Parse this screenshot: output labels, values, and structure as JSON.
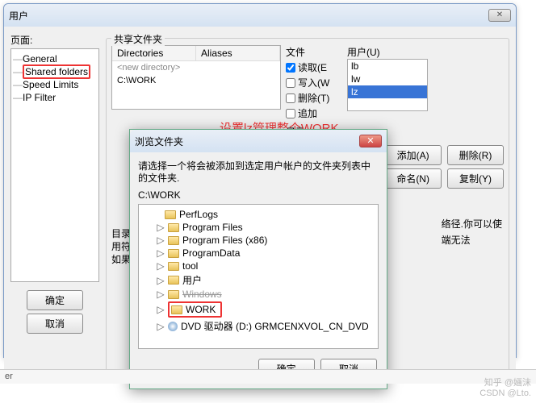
{
  "main": {
    "title": "用户",
    "page_label": "页面:",
    "tree": {
      "i0": "General",
      "i1": "Shared folders",
      "i2": "Speed Limits",
      "i3": "IP Filter"
    },
    "ok": "确定",
    "cancel": "取消",
    "shared_label": "共享文件夹",
    "dir_head_a": "Directories",
    "dir_head_b": "Aliases",
    "dir_new": "<new directory>",
    "dir_path": "C:\\WORK",
    "files_label": "文件",
    "ck_read": "读取(E",
    "ck_write": "写入(W",
    "ck_del": "删除(T)",
    "ck_append": "追加",
    "dirs_label": "目录",
    "users_label": "用户(U)",
    "users": {
      "u0": "lb",
      "u1": "lw",
      "u2": "lz"
    },
    "btn_add": "添加(A)",
    "btn_del": "删除(R)",
    "btn_rename": "命名(N)",
    "btn_copy": "复制(Y)",
    "txt_dirs": "目录须",
    "txt_alias": "用符",
    "txt_if": "如果你",
    "tip1": "络径.你可以使",
    "tip2": "端无法",
    "annotation": "设置lz管理整个WORK"
  },
  "dlg": {
    "title": "浏览文件夹",
    "instr": "请选择一个将会被添加到选定用户帐户的文件夹列表中的文件夹.",
    "path": "C:\\WORK",
    "items": {
      "f0": "PerfLogs",
      "f1": "Program Files",
      "f2": "Program Files (x86)",
      "f3": "ProgramData",
      "f4": "tool",
      "f5": "用户",
      "f6": "Windows",
      "f7": "WORK",
      "f8": "DVD 驱动器 (D:) GRMCENXVOL_CN_DVD"
    },
    "ok": "确定",
    "cancel": "取消"
  },
  "status": "er",
  "wm1": "知乎 @婳沫",
  "wm2": "CSDN @Lto."
}
